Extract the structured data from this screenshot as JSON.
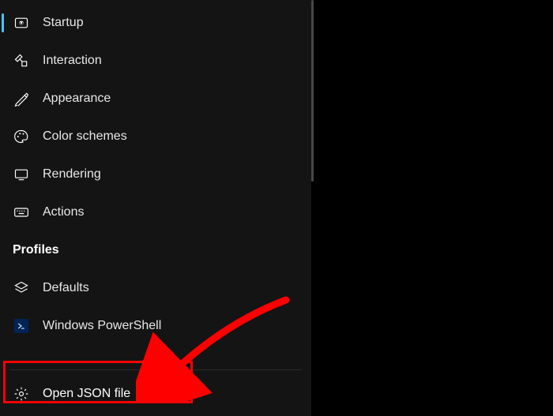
{
  "sidebar": {
    "items": [
      {
        "label": "Startup",
        "icon": "startup-icon",
        "selected": true
      },
      {
        "label": "Interaction",
        "icon": "interaction-icon",
        "selected": false
      },
      {
        "label": "Appearance",
        "icon": "appearance-icon",
        "selected": false
      },
      {
        "label": "Color schemes",
        "icon": "color-schemes-icon",
        "selected": false
      },
      {
        "label": "Rendering",
        "icon": "rendering-icon",
        "selected": false
      },
      {
        "label": "Actions",
        "icon": "actions-icon",
        "selected": false
      }
    ],
    "section_header": "Profiles",
    "profiles": [
      {
        "label": "Defaults",
        "icon": "defaults-icon"
      },
      {
        "label": "Windows PowerShell",
        "icon": "powershell-icon"
      }
    ],
    "bottom": {
      "label": "Open JSON file",
      "icon": "gear-icon"
    }
  }
}
